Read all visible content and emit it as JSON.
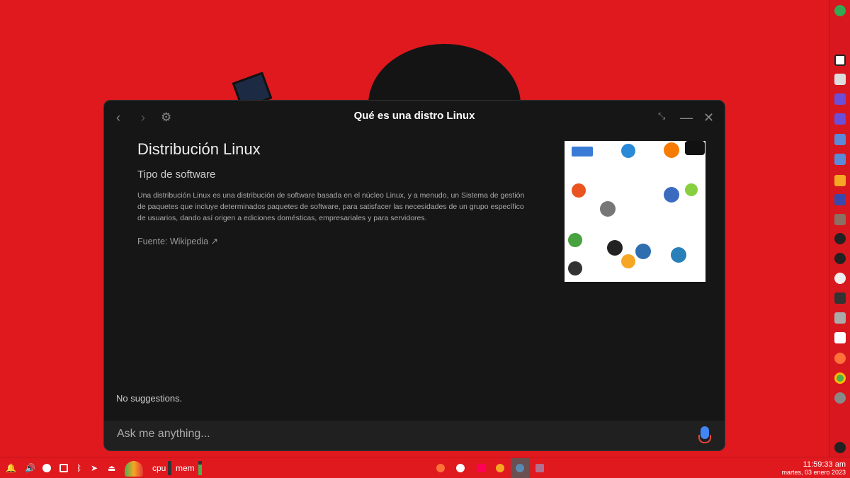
{
  "window": {
    "title": "Qué es una distro Linux"
  },
  "result": {
    "heading": "Distribución Linux",
    "subtitle": "Tipo de software",
    "description": "Una distribución Linux es una distribución de software basada en el núcleo Linux, y a menudo, un Sistema de gestión de paquetes que incluye determinados paquetes de software, para satisfacer las necesidades de un grupo específico de usuarios, dando así origen a ediciones domésticas, empresariales y para servidores.",
    "source": "Fuente: Wikipedia"
  },
  "suggestions": "No suggestions.",
  "input": {
    "placeholder": "Ask me anything...",
    "value": ""
  },
  "panel": {
    "cpu_label": "cpu",
    "mem_label": "mem",
    "time": "11:59:33 am",
    "date": "martes, 03 enero 2023"
  },
  "colors": {
    "desktop": "#e0191f",
    "window": "#161616",
    "accent_mic": "#4285f4"
  }
}
